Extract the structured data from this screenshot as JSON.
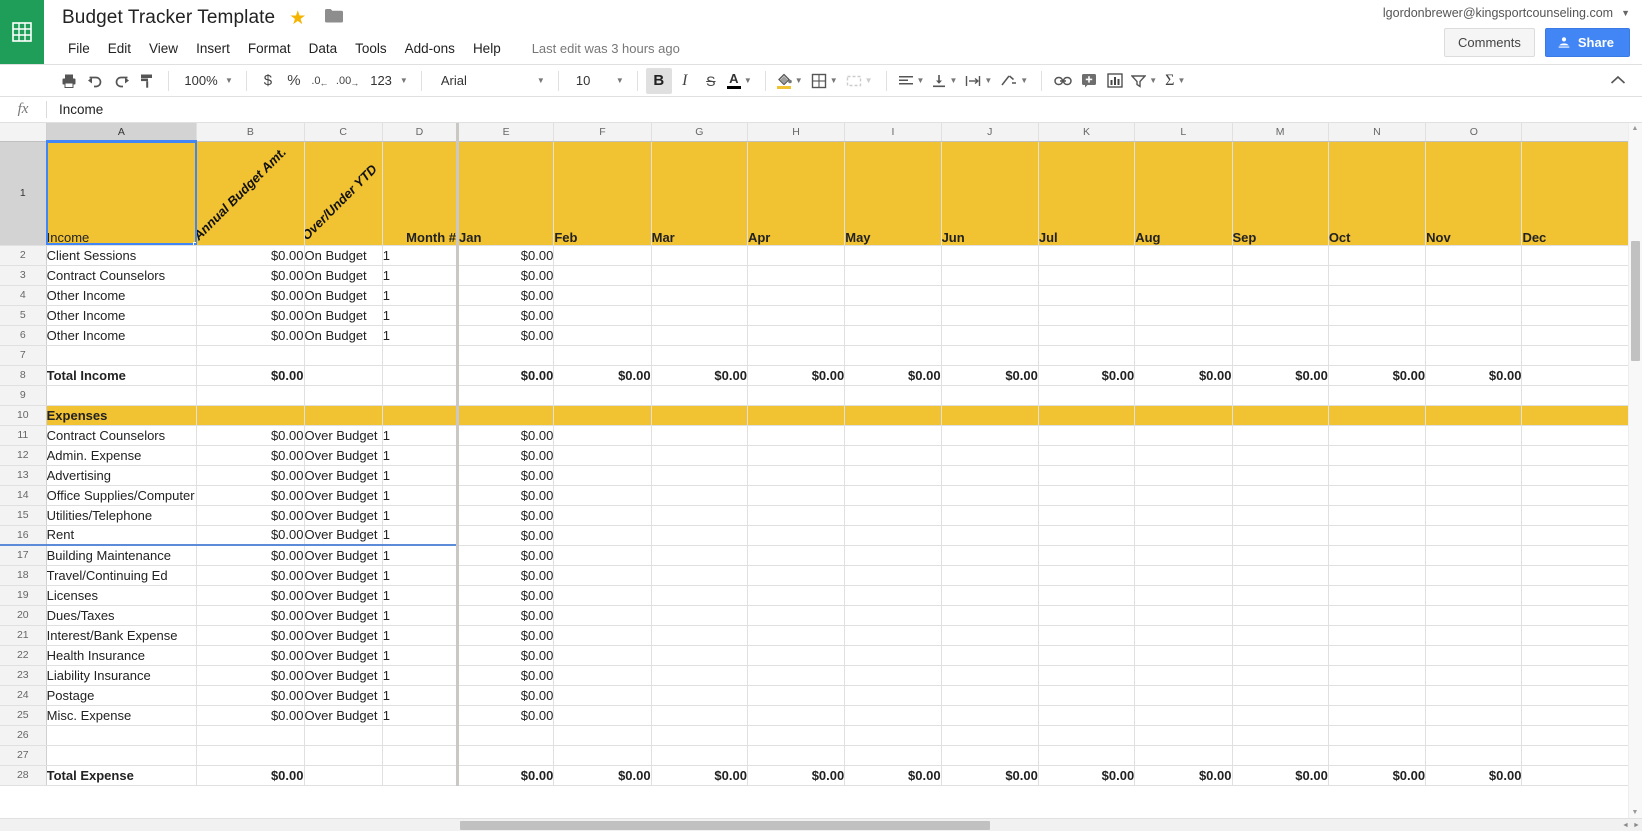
{
  "app": {
    "logo_icon": "sheets-grid-icon",
    "doc_title": "Budget Tracker Template",
    "star_icon": "star-icon",
    "folder_icon": "folder-icon",
    "last_edit": "Last edit was 3 hours ago",
    "account_email": "lgordonbrewer@kingsportcounseling.com",
    "account_caret_icon": "chevron-down-icon",
    "comments_label": "Comments",
    "share_label": "Share",
    "share_icon": "share-person-icon"
  },
  "menus": [
    "File",
    "Edit",
    "View",
    "Insert",
    "Format",
    "Data",
    "Tools",
    "Add-ons",
    "Help"
  ],
  "toolbar": {
    "print_icon": "print-icon",
    "undo_icon": "undo-arrow-icon",
    "redo_icon": "redo-arrow-icon",
    "paint_format_icon": "paint-format-icon",
    "zoom_value": "100%",
    "currency_icon": "$",
    "percent_icon": "%",
    "decrease_decimal_icon": ".0",
    "increase_decimal_icon": ".00",
    "more_formats_label": "123",
    "font_family": "Arial",
    "font_size": "10",
    "bold_label": "B",
    "italic_label": "I",
    "strikethrough_label": "S",
    "text_color_label": "A",
    "text_color_swatch": "#000000",
    "fill_color_icon": "fill-bucket-icon",
    "fill_color_swatch": "#f1c232",
    "borders_icon": "borders-icon",
    "merge_cells_icon": "merge-cells-icon",
    "horizontal_align_icon": "align-left-icon",
    "vertical_align_icon": "align-bottom-icon",
    "text_wrap_icon": "text-wrap-icon",
    "text_rotation_icon": "text-rotation-icon",
    "insert_link_icon": "link-icon",
    "insert_comment_icon": "add-comment-icon",
    "insert_chart_icon": "chart-icon",
    "filter_icon": "filter-icon",
    "functions_icon": "sigma-icon",
    "collapse_icon": "chevron-up-icon"
  },
  "formula_bar": {
    "fx_label": "fx",
    "value": "Income"
  },
  "grid": {
    "selected_cell": "A1",
    "column_letters": [
      "A",
      "B",
      "C",
      "D",
      "E",
      "F",
      "G",
      "H",
      "I",
      "J",
      "K",
      "L",
      "M",
      "N",
      "O"
    ],
    "row_numbers": [
      1,
      2,
      3,
      4,
      5,
      6,
      7,
      8,
      9,
      10,
      11,
      12,
      13,
      14,
      15,
      16,
      17,
      18,
      19,
      20,
      21,
      22,
      23,
      24,
      25,
      26,
      27,
      28
    ],
    "header_row": {
      "income_label": "Income",
      "annual_budget_label": "Annual Budget Amt.",
      "over_under_label": "Over/Under YTD",
      "month_num_label": "Month #",
      "months": [
        "Jan",
        "Feb",
        "Mar",
        "Apr",
        "May",
        "Jun",
        "Jul",
        "Aug",
        "Sep",
        "Oct",
        "Nov",
        "Dec"
      ]
    },
    "income_rows": [
      {
        "row": 2,
        "name": "Client Sessions",
        "budget": "$0.00",
        "status": "On Budget",
        "month": "1",
        "jan": "$0.00"
      },
      {
        "row": 3,
        "name": "Contract Counselors",
        "budget": "$0.00",
        "status": "On Budget",
        "month": "1",
        "jan": "$0.00"
      },
      {
        "row": 4,
        "name": "Other Income",
        "budget": "$0.00",
        "status": "On Budget",
        "month": "1",
        "jan": "$0.00"
      },
      {
        "row": 5,
        "name": "Other Income",
        "budget": "$0.00",
        "status": "On Budget",
        "month": "1",
        "jan": "$0.00"
      },
      {
        "row": 6,
        "name": "Other Income",
        "budget": "$0.00",
        "status": "On Budget",
        "month": "1",
        "jan": "$0.00"
      }
    ],
    "total_income_row": {
      "row": 8,
      "name": "Total Income",
      "budget": "$0.00",
      "monthly": [
        "$0.00",
        "$0.00",
        "$0.00",
        "$0.00",
        "$0.00",
        "$0.00",
        "$0.00",
        "$0.00",
        "$0.00",
        "$0.00",
        "$0.00",
        ""
      ]
    },
    "expenses_header": {
      "row": 10,
      "label": "Expenses"
    },
    "expense_rows": [
      {
        "row": 11,
        "name": "Contract Counselors",
        "budget": "$0.00",
        "status": "Over Budget",
        "month": "1",
        "jan": "$0.00"
      },
      {
        "row": 12,
        "name": "Admin. Expense",
        "budget": "$0.00",
        "status": "Over Budget",
        "month": "1",
        "jan": "$0.00"
      },
      {
        "row": 13,
        "name": "Advertising",
        "budget": "$0.00",
        "status": "Over Budget",
        "month": "1",
        "jan": "$0.00"
      },
      {
        "row": 14,
        "name": "Office Supplies/Computer",
        "budget": "$0.00",
        "status": "Over Budget",
        "month": "1",
        "jan": "$0.00"
      },
      {
        "row": 15,
        "name": "Utilities/Telephone",
        "budget": "$0.00",
        "status": "Over Budget",
        "month": "1",
        "jan": "$0.00"
      },
      {
        "row": 16,
        "name": "Rent",
        "budget": "$0.00",
        "status": "Over Budget",
        "month": "1",
        "jan": "$0.00"
      },
      {
        "row": 17,
        "name": "Building Maintenance",
        "budget": "$0.00",
        "status": "Over Budget",
        "month": "1",
        "jan": "$0.00"
      },
      {
        "row": 18,
        "name": "Travel/Continuing Ed",
        "budget": "$0.00",
        "status": "Over Budget",
        "month": "1",
        "jan": "$0.00"
      },
      {
        "row": 19,
        "name": "Licenses",
        "budget": "$0.00",
        "status": "Over Budget",
        "month": "1",
        "jan": "$0.00"
      },
      {
        "row": 20,
        "name": "Dues/Taxes",
        "budget": "$0.00",
        "status": "Over Budget",
        "month": "1",
        "jan": "$0.00"
      },
      {
        "row": 21,
        "name": "Interest/Bank Expense",
        "budget": "$0.00",
        "status": "Over Budget",
        "month": "1",
        "jan": "$0.00"
      },
      {
        "row": 22,
        "name": "Health Insurance",
        "budget": "$0.00",
        "status": "Over Budget",
        "month": "1",
        "jan": "$0.00"
      },
      {
        "row": 23,
        "name": "Liability Insurance",
        "budget": "$0.00",
        "status": "Over Budget",
        "month": "1",
        "jan": "$0.00"
      },
      {
        "row": 24,
        "name": "Postage",
        "budget": "$0.00",
        "status": "Over Budget",
        "month": "1",
        "jan": "$0.00"
      },
      {
        "row": 25,
        "name": "Misc. Expense",
        "budget": "$0.00",
        "status": "Over Budget",
        "month": "1",
        "jan": "$0.00"
      }
    ],
    "blank_rows": [
      7,
      9,
      26,
      27
    ],
    "total_expense_row": {
      "row": 28,
      "name": "Total Expense",
      "budget": "$0.00",
      "monthly": [
        "$0.00",
        "$0.00",
        "$0.00",
        "$0.00",
        "$0.00",
        "$0.00",
        "$0.00",
        "$0.00",
        "$0.00",
        "$0.00",
        "$0.00",
        ""
      ]
    }
  },
  "scrollbars": {
    "h_left_arrow_icon": "triangle-left-icon",
    "h_right_arrow_icon": "triangle-right-icon",
    "v_up_arrow_icon": "triangle-up-icon",
    "v_down_arrow_icon": "triangle-down-icon"
  },
  "colors": {
    "gold": "#f1c232",
    "brand_green": "#1e9e59",
    "accent_blue": "#4285f4"
  }
}
